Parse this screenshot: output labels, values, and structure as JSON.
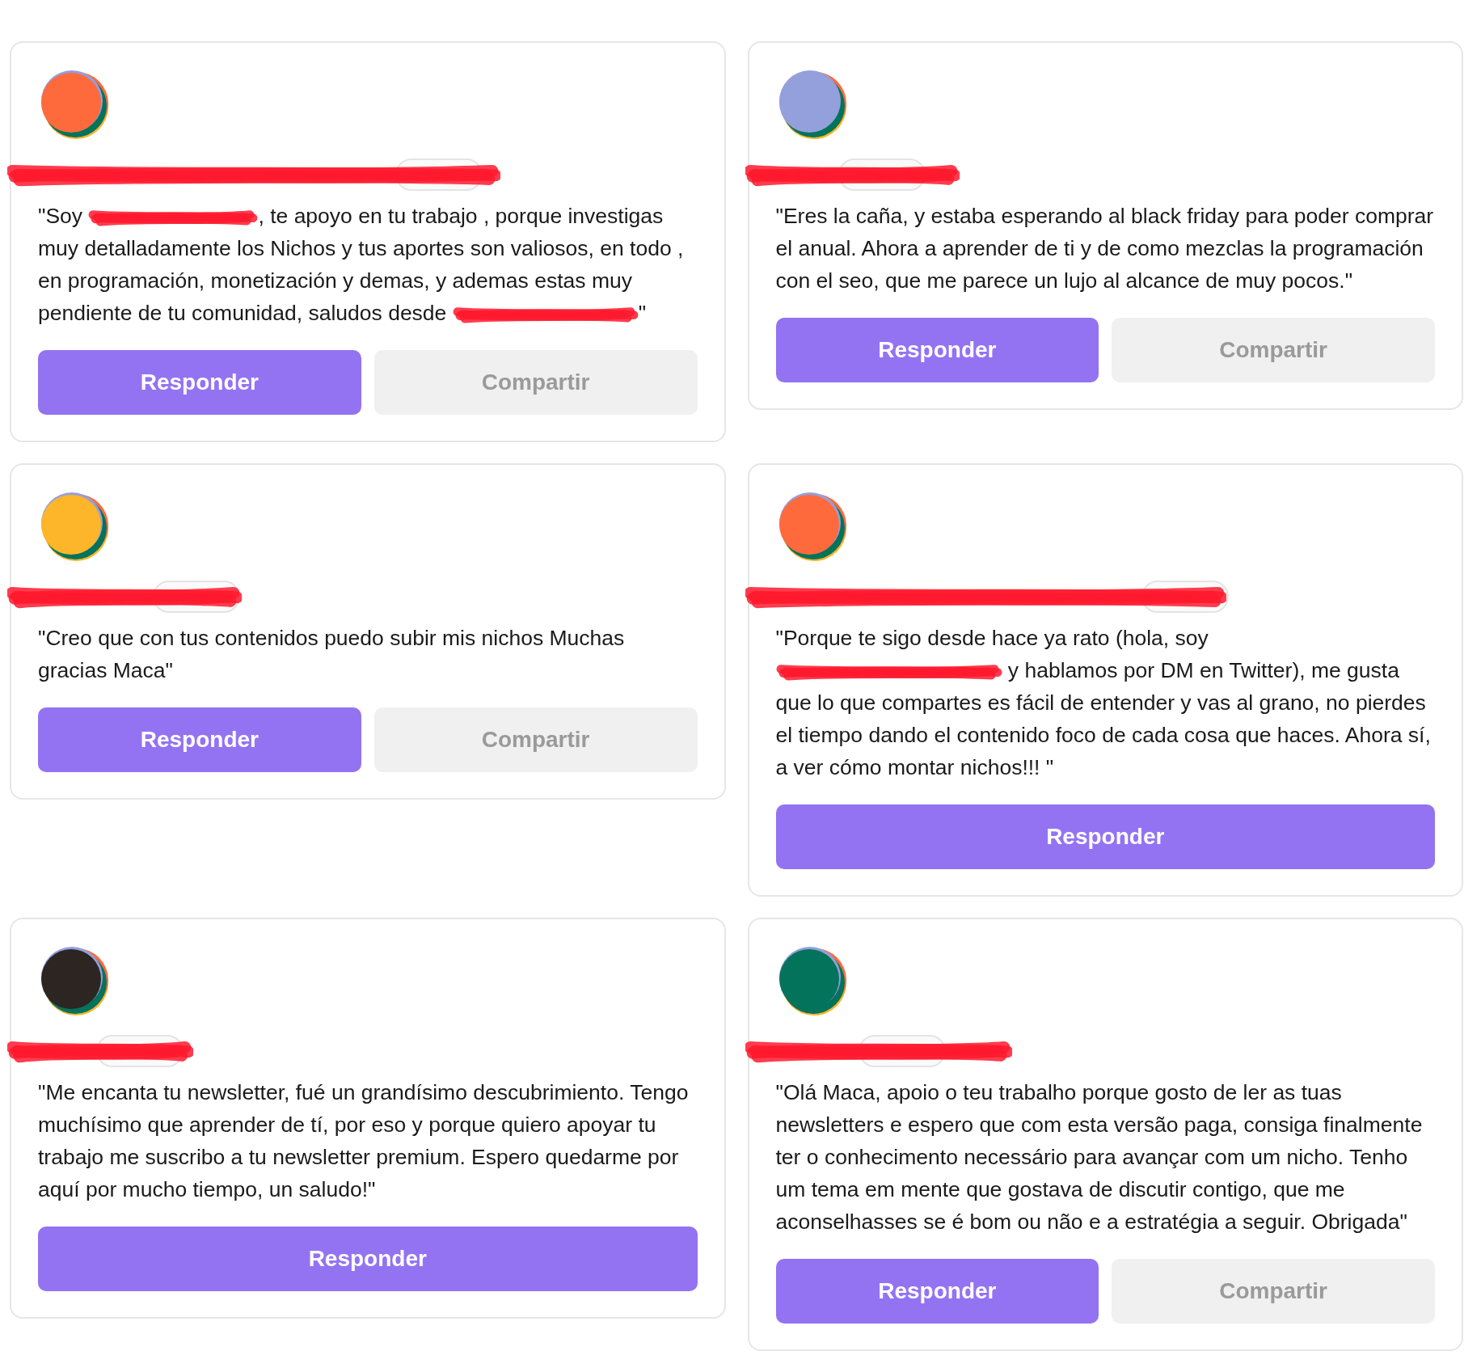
{
  "cards": [
    {
      "color": "#ff6a3d",
      "quote": [
        {
          "kind": "text",
          "text": "\"Soy "
        },
        {
          "kind": "redaction"
        },
        {
          "kind": "text",
          "text": ", te apoyo en tu trabajo , porque investigas muy detalladamente los Nichos y tus aportes son valiosos, en todo , en programación, monetización y demas, y ademas estas muy pendiente de tu comunidad, saludos desde "
        },
        {
          "kind": "redaction"
        },
        {
          "kind": "text",
          "text": "\""
        }
      ],
      "actions": [
        {
          "kind": "primary",
          "label": "Responder"
        },
        {
          "kind": "secondary",
          "label": "Compartir"
        }
      ]
    },
    {
      "color": "#93a0dc",
      "quote": [
        {
          "kind": "text",
          "text": "\"Eres la caña, y estaba esperando al black friday para poder comprar el anual. Ahora a aprender de ti y de como mezclas la programación con el seo, que me parece un lujo al alcance de muy pocos.\""
        }
      ],
      "actions": [
        {
          "kind": "primary",
          "label": "Responder"
        },
        {
          "kind": "secondary",
          "label": "Compartir"
        }
      ]
    },
    {
      "color": "#fdb52a",
      "quote": [
        {
          "kind": "text",
          "text": "\"Creo que con tus contenidos puedo subir mis nichos Muchas gracias Maca\""
        }
      ],
      "actions": [
        {
          "kind": "primary",
          "label": "Responder"
        },
        {
          "kind": "secondary",
          "label": "Compartir"
        }
      ]
    },
    {
      "color": "#ff6a3d",
      "quote": [
        {
          "kind": "text",
          "text": "\"Porque te sigo desde hace ya rato (hola, soy "
        },
        {
          "kind": "redaction"
        },
        {
          "kind": "text",
          "text": " y hablamos por DM en Twitter), me gusta que lo que compartes es fácil de entender y vas al grano, no pierdes el tiempo dando el contenido foco de cada cosa que haces. Ahora sí, a ver cómo montar nichos!!! \""
        }
      ],
      "actions": [
        {
          "kind": "primary",
          "label": "Responder"
        }
      ]
    },
    {
      "color": "#2c2522",
      "quote": [
        {
          "kind": "text",
          "text": "\"Me encanta tu newsletter, fué un grandísimo descubrimiento. Tengo muchísimo que aprender de tí, por eso y porque quiero apoyar tu trabajo me suscribo a tu newsletter premium. Espero quedarme por aquí por mucho tiempo, un saludo!\""
        }
      ],
      "actions": [
        {
          "kind": "primary",
          "label": "Responder"
        }
      ]
    },
    {
      "color": "#03735c",
      "quote": [
        {
          "kind": "text",
          "text": "\"Olá Maca, apoio o teu trabalho porque gosto de ler as tuas newsletters e espero que com esta versão paga, consiga finalmente ter o conhecimento necessário para avançar com um nicho. Tenho um tema em mente que gostava de discutir contigo, que me aconselhasses se é bom ou não e a estratégia a seguir. Obrigada\""
        }
      ],
      "actions": [
        {
          "kind": "primary",
          "label": "Responder"
        },
        {
          "kind": "secondary",
          "label": "Compartir"
        }
      ]
    }
  ]
}
